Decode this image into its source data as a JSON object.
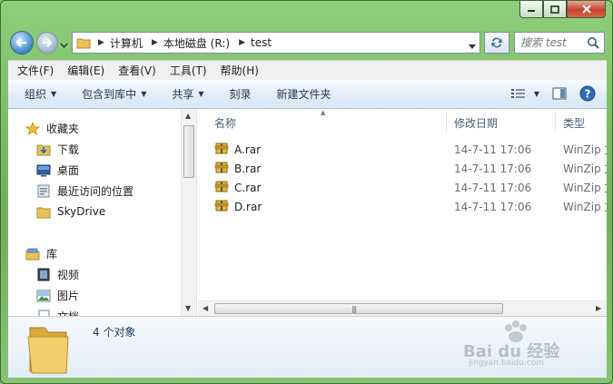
{
  "address": {
    "parts": [
      "计算机",
      "本地磁盘 (R:)",
      "test"
    ]
  },
  "search": {
    "placeholder": "搜索 test"
  },
  "menu": [
    "文件(F)",
    "编辑(E)",
    "查看(V)",
    "工具(T)",
    "帮助(H)"
  ],
  "toolbar": {
    "organize": "组织",
    "include": "包含到库中",
    "share": "共享",
    "burn": "刻录",
    "new_folder": "新建文件夹"
  },
  "nav": {
    "favorites": "收藏夹",
    "downloads": "下载",
    "desktop": "桌面",
    "recent": "最近访问的位置",
    "skydrive": "SkyDrive",
    "libraries": "库",
    "videos": "视频",
    "pictures": "图片",
    "documents": "文档"
  },
  "columns": {
    "name": "名称",
    "date": "修改日期",
    "type": "类型"
  },
  "files": [
    {
      "name": "A.rar",
      "date": "14-7-11 17:06",
      "type": "WinZip 文件"
    },
    {
      "name": "B.rar",
      "date": "14-7-11 17:06",
      "type": "WinZip 文件"
    },
    {
      "name": "C.rar",
      "date": "14-7-11 17:06",
      "type": "WinZip 文件"
    },
    {
      "name": "D.rar",
      "date": "14-7-11 17:06",
      "type": "WinZip 文件"
    }
  ],
  "details": {
    "count": "4 个对象"
  },
  "watermark": {
    "brand": "Bai du 经验",
    "site": "jingyan.baidu.com"
  },
  "colors": {
    "accent": "#3a86c7",
    "window_frame": "#7fb96a",
    "header_text": "#4c607a"
  }
}
